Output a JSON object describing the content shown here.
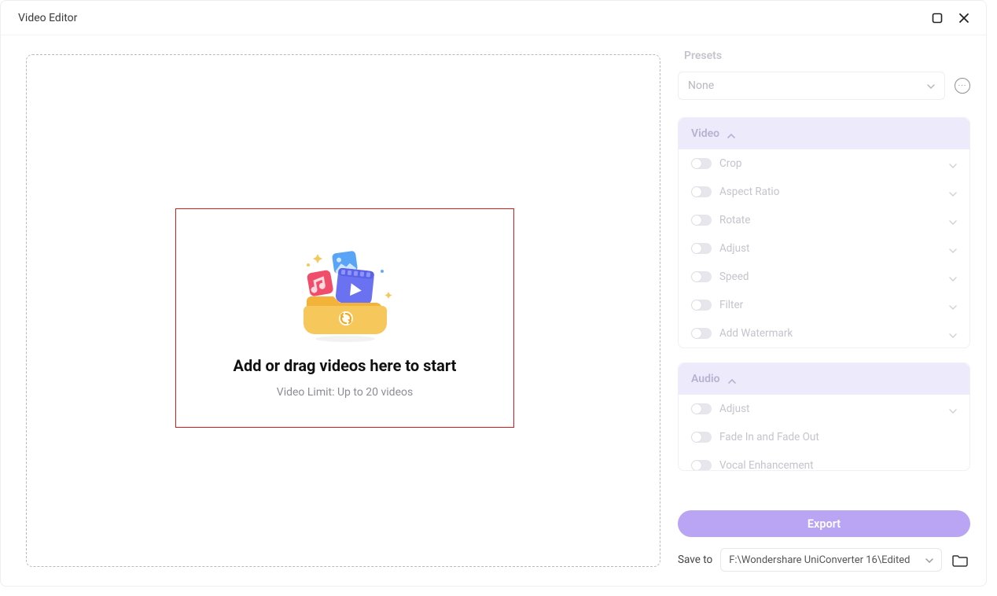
{
  "window": {
    "title": "Video Editor"
  },
  "dropzone": {
    "title": "Add or drag videos here to start",
    "subtitle": "Video Limit: Up to 20 videos"
  },
  "presets": {
    "label": "Presets",
    "selected": "None"
  },
  "sections": {
    "video": {
      "title": "Video",
      "options": [
        {
          "label": "Crop"
        },
        {
          "label": "Aspect Ratio"
        },
        {
          "label": "Rotate"
        },
        {
          "label": "Adjust"
        },
        {
          "label": "Speed"
        },
        {
          "label": "Filter"
        },
        {
          "label": "Add Watermark"
        }
      ]
    },
    "audio": {
      "title": "Audio",
      "options": [
        {
          "label": "Adjust"
        },
        {
          "label": "Fade In and Fade Out"
        },
        {
          "label": "Vocal Enhancement"
        }
      ]
    }
  },
  "footer": {
    "export_label": "Export",
    "save_to_label": "Save to",
    "save_path": "F:\\Wondershare UniConverter 16\\Edited"
  }
}
